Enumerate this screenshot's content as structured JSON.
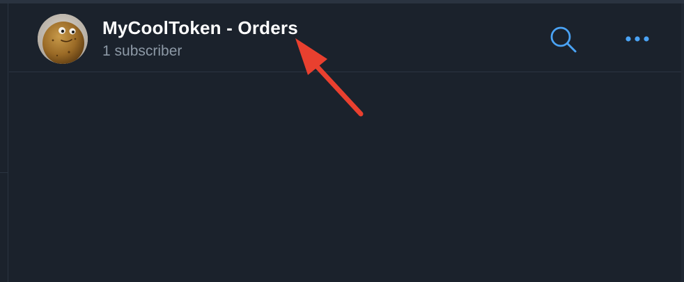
{
  "channel": {
    "title": "MyCoolToken - Orders",
    "subtitle": "1 subscriber"
  },
  "header_actions": {
    "search_icon": "search-icon",
    "more_icon": "more-horizontal-icon"
  },
  "colors": {
    "background": "#1b222c",
    "accent": "#4aa3f5",
    "title": "#ffffff",
    "subtitle": "#8d99a6",
    "annotation": "#e9402f"
  }
}
